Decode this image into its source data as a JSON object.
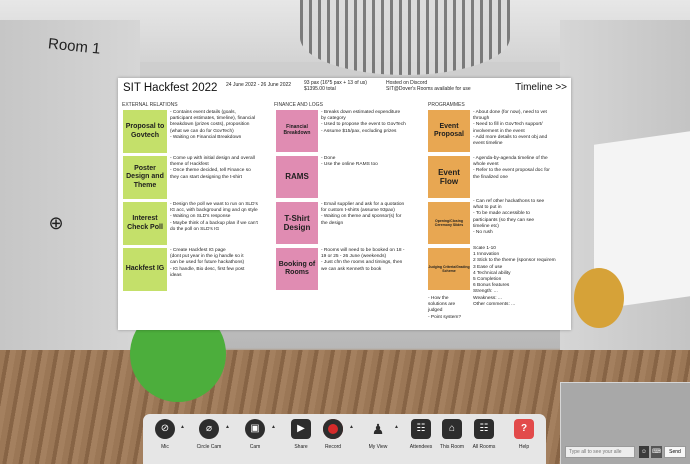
{
  "room": {
    "label": "Room 1"
  },
  "board": {
    "title": "SIT Hackfest 2022",
    "dates": "24 June 2022 - 26 June 2022",
    "pax": "93 pax (16*5 pax + 13 of us)\n$1395.00 total",
    "hosted": "Hosted on Discord\nSIT@Dover's Rooms available for use",
    "timeline": "Timeline >>",
    "sections": {
      "external": "EXTERNAL RELATIONS",
      "finance": "FINANCE AND LOGS",
      "programmes": "PROGRAMMES"
    },
    "external_notes": [
      {
        "label": "Proposal to Govtech",
        "text": "- Contains event details (goals,\nparticipant estimates, timeline), financial\nbreakdown (prizes costs), proposition\n(what we can do for GovTech)\n- Waiting on Financial Breakdown"
      },
      {
        "label": "Poster Design and Theme",
        "text": "- Come up with initial design and overall\ntheme of Hackfest\n- Once theme decided, tell Finance so\nthey can start designing the t-shirt"
      },
      {
        "label": "Interest Check Poll",
        "text": "- Design the poll we want to run on SLD's\nIG acc, with background img and qn style\n- Waiting on SLD's response\n- Maybe think of a backup plan if we can't\ndo the poll on SLD's IG"
      },
      {
        "label": "Hackfest IG",
        "text": "- Create Hackfest IG page\n(dont put year in the ig handle so it\ncan be used for future hackathons)\n- IG handle, Bio desc, first few post\nideas"
      }
    ],
    "finance_notes": [
      {
        "label": "Financial Breakdown",
        "text": "- Breaks down estimated expenditure\nby category\n- Used to propose the event to GovTech\n- Assume $15/pax, excluding prizes"
      },
      {
        "label": "RAMS",
        "text": "- Done\n- Use the online RAMS too"
      },
      {
        "label": "T-Shirt Design",
        "text": "- Email supplier and ask for a quotation\nfor custom t-shirts (assume 93pax)\n- Waiting on theme and sponsor(s) for\nthe design"
      },
      {
        "label": "Booking of Rooms",
        "text": "- Rooms will need to be booked on 18 -\n19 or 25 - 26 June (weekends)\n- Just cfm the rooms and timings, then\nwe can ask Kenneth to book"
      }
    ],
    "programme_notes": [
      {
        "label": "Event Proposal",
        "text": "- About done (for now), need to vet\nthrough\n- Need to fill in GovTech support/\ninvolvement in the event\n- Add more details to event obj and\nevent timeline"
      },
      {
        "label": "Event Flow",
        "text": "- Agenda-by-agenda timeline of the\nwhole event\n- Refer to the event proposal doc for\nthe finalized one"
      },
      {
        "label": "Opening/Closing Ceremony Slides",
        "text": "- Can ref other hackathons to see\nwhat to put in\n- To be made accessible to\nparticipants (so they can see\ntimeline etc)\n- No rush"
      },
      {
        "label": "Judging Criteria/Grading Scheme",
        "text": "Scale 1-10\n1 Innovation\n2 Stick to the theme (sponsor requirem\n3 Ease of use\n4 Technical ability\n5 Completion\n6 Bonus features\nStrength: ...\nWeakness: ...\nOther comments: ..."
      }
    ],
    "judging_side": "- How the\nsolutions are\njudged\n- Point system?"
  },
  "toolbar": {
    "mic": "Mic",
    "circle_cam": "Circle Cam",
    "cam": "Cam",
    "share": "Share",
    "record": "Record",
    "my_view": "My View",
    "attendees": "Attendees",
    "this_room": "This Room",
    "all_rooms": "All Rooms",
    "help": "Help"
  },
  "chat": {
    "placeholder": "Type all to see your alle",
    "send": "Send"
  },
  "colors": {
    "green_note": "#c4e06a",
    "pink_note": "#e08cb2",
    "orange_note": "#e8a752",
    "green_circle": "#4cae3c",
    "record_red": "#d62a2a",
    "help_red": "#e24a4a"
  }
}
